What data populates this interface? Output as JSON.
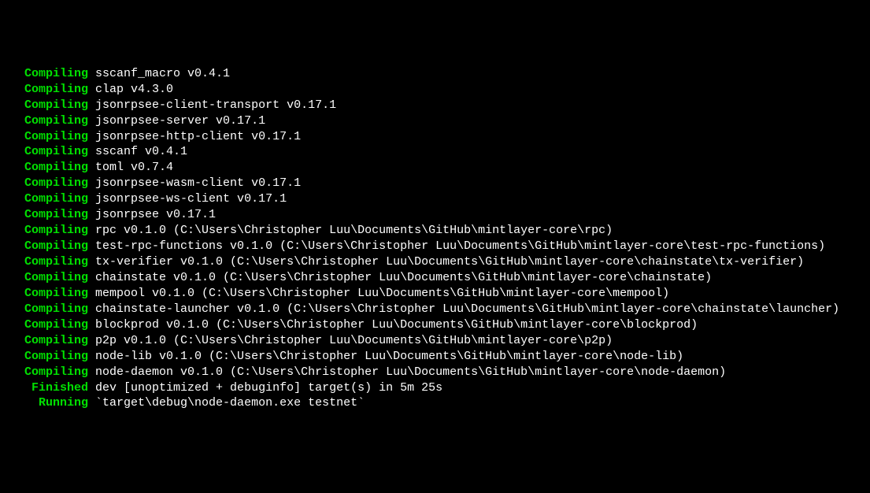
{
  "lines": [
    {
      "status": "Compiling",
      "text": "sscanf_macro v0.4.1",
      "indent": 3
    },
    {
      "status": "Compiling",
      "text": "clap v4.3.0",
      "indent": 3
    },
    {
      "status": "Compiling",
      "text": "jsonrpsee-client-transport v0.17.1",
      "indent": 3
    },
    {
      "status": "Compiling",
      "text": "jsonrpsee-server v0.17.1",
      "indent": 3
    },
    {
      "status": "Compiling",
      "text": "jsonrpsee-http-client v0.17.1",
      "indent": 3
    },
    {
      "status": "Compiling",
      "text": "sscanf v0.4.1",
      "indent": 3
    },
    {
      "status": "Compiling",
      "text": "toml v0.7.4",
      "indent": 3
    },
    {
      "status": "Compiling",
      "text": "jsonrpsee-wasm-client v0.17.1",
      "indent": 3
    },
    {
      "status": "Compiling",
      "text": "jsonrpsee-ws-client v0.17.1",
      "indent": 3
    },
    {
      "status": "Compiling",
      "text": "jsonrpsee v0.17.1",
      "indent": 3
    },
    {
      "status": "Compiling",
      "text": "rpc v0.1.0 (C:\\Users\\Christopher Luu\\Documents\\GitHub\\mintlayer-core\\rpc)",
      "indent": 3
    },
    {
      "status": "Compiling",
      "text": "test-rpc-functions v0.1.0 (C:\\Users\\Christopher Luu\\Documents\\GitHub\\mintlayer-core\\test-rpc-functions)",
      "indent": 3
    },
    {
      "status": "Compiling",
      "text": "tx-verifier v0.1.0 (C:\\Users\\Christopher Luu\\Documents\\GitHub\\mintlayer-core\\chainstate\\tx-verifier)",
      "indent": 3
    },
    {
      "status": "Compiling",
      "text": "chainstate v0.1.0 (C:\\Users\\Christopher Luu\\Documents\\GitHub\\mintlayer-core\\chainstate)",
      "indent": 3
    },
    {
      "status": "Compiling",
      "text": "mempool v0.1.0 (C:\\Users\\Christopher Luu\\Documents\\GitHub\\mintlayer-core\\mempool)",
      "indent": 3
    },
    {
      "status": "Compiling",
      "text": "chainstate-launcher v0.1.0 (C:\\Users\\Christopher Luu\\Documents\\GitHub\\mintlayer-core\\chainstate\\launcher)",
      "indent": 3
    },
    {
      "status": "Compiling",
      "text": "blockprod v0.1.0 (C:\\Users\\Christopher Luu\\Documents\\GitHub\\mintlayer-core\\blockprod)",
      "indent": 3
    },
    {
      "status": "Compiling",
      "text": "p2p v0.1.0 (C:\\Users\\Christopher Luu\\Documents\\GitHub\\mintlayer-core\\p2p)",
      "indent": 3
    },
    {
      "status": "Compiling",
      "text": "node-lib v0.1.0 (C:\\Users\\Christopher Luu\\Documents\\GitHub\\mintlayer-core\\node-lib)",
      "indent": 3
    },
    {
      "status": "Compiling",
      "text": "node-daemon v0.1.0 (C:\\Users\\Christopher Luu\\Documents\\GitHub\\mintlayer-core\\node-daemon)",
      "indent": 3
    },
    {
      "status": "Finished",
      "text": "dev [unoptimized + debuginfo] target(s) in 5m 25s",
      "indent": 4
    },
    {
      "status": "Running",
      "text": "`target\\debug\\node-daemon.exe testnet`",
      "indent": 5
    }
  ]
}
